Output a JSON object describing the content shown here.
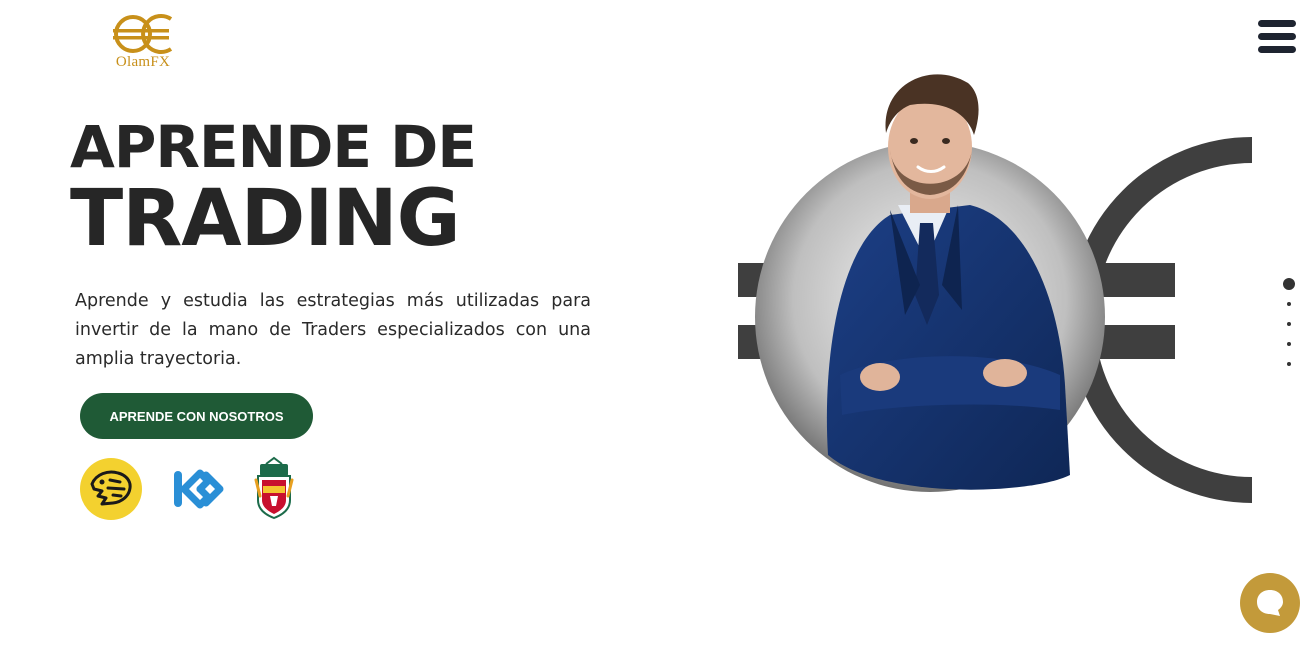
{
  "brand": {
    "logo_icon": "olamfx-euro-logo-icon",
    "name": "OlamFX",
    "color": "#c8901a"
  },
  "header": {
    "menu_icon": "hamburger-menu-icon"
  },
  "hero": {
    "title_line1": "APRENDE DE",
    "title_line2": "TRADING",
    "description": "Aprende y estudia las estrategias más utilizadas para invertir de la mano de Traders especializados con una amplia trayectoria.",
    "cta_label": "APRENDE CON NOSOTROS",
    "cta_color": "#1f5a36",
    "image": "man-in-blue-suit-arms-crossed",
    "background_symbol": "euro-symbol"
  },
  "partners": [
    {
      "name": "tiger-logo",
      "bg": "#f3d12f"
    },
    {
      "name": "kucoin-logo",
      "color": "#2a8fd6"
    },
    {
      "name": "liverpool-fc-crest",
      "color": "#c8102e"
    }
  ],
  "slider": {
    "total": 5,
    "active_index": 0
  },
  "chat": {
    "icon": "chat-bubble-icon",
    "color": "#c39a3a"
  }
}
